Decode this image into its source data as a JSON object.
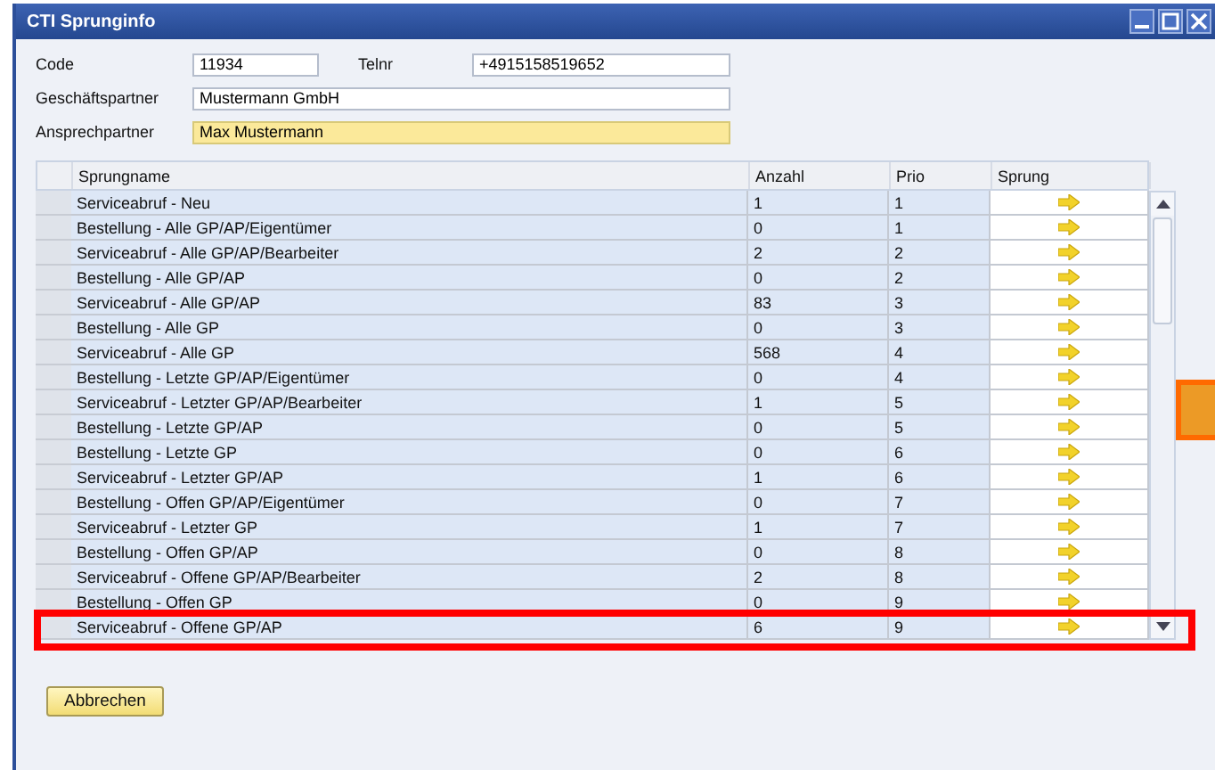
{
  "window": {
    "title": "CTI Sprunginfo"
  },
  "fields": [
    {
      "label": "Code",
      "value": "11934"
    },
    {
      "label": "Telnr",
      "value": "+4915158519652"
    },
    {
      "label": "Geschäftspartner",
      "value": "Mustermann GmbH"
    },
    {
      "label": "Ansprechpartner",
      "value": "Max Mustermann",
      "focused": true
    }
  ],
  "table": {
    "columns": [
      "Sprungname",
      "Anzahl",
      "Prio",
      "Sprung"
    ],
    "rows": [
      {
        "name": "Serviceabruf - Neu",
        "anzahl": "1",
        "prio": "1",
        "highlighted": false
      },
      {
        "name": "Bestellung - Alle GP/AP/Eigentümer",
        "anzahl": "0",
        "prio": "1",
        "highlighted": false
      },
      {
        "name": "Serviceabruf - Alle GP/AP/Bearbeiter",
        "anzahl": "2",
        "prio": "2",
        "highlighted": false
      },
      {
        "name": "Bestellung - Alle GP/AP",
        "anzahl": "0",
        "prio": "2",
        "highlighted": false
      },
      {
        "name": "Serviceabruf - Alle GP/AP",
        "anzahl": "83",
        "prio": "3",
        "highlighted": false
      },
      {
        "name": "Bestellung - Alle GP",
        "anzahl": "0",
        "prio": "3",
        "highlighted": false
      },
      {
        "name": "Serviceabruf - Alle GP",
        "anzahl": "568",
        "prio": "4",
        "highlighted": false
      },
      {
        "name": "Bestellung - Letzte GP/AP/Eigentümer",
        "anzahl": "0",
        "prio": "4",
        "highlighted": false
      },
      {
        "name": "Serviceabruf - Letzter GP/AP/Bearbeiter",
        "anzahl": "1",
        "prio": "5",
        "highlighted": false
      },
      {
        "name": "Bestellung - Letzte GP/AP",
        "anzahl": "0",
        "prio": "5",
        "highlighted": false
      },
      {
        "name": "Bestellung - Letzte GP",
        "anzahl": "0",
        "prio": "6",
        "highlighted": false
      },
      {
        "name": "Serviceabruf - Letzter GP/AP",
        "anzahl": "1",
        "prio": "6",
        "highlighted": false
      },
      {
        "name": "Bestellung - Offen GP/AP/Eigentümer",
        "anzahl": "0",
        "prio": "7",
        "highlighted": false
      },
      {
        "name": "Serviceabruf - Letzter GP",
        "anzahl": "1",
        "prio": "7",
        "highlighted": false
      },
      {
        "name": "Bestellung - Offen GP/AP",
        "anzahl": "0",
        "prio": "8",
        "highlighted": false
      },
      {
        "name": "Serviceabruf - Offene GP/AP/Bearbeiter",
        "anzahl": "2",
        "prio": "8",
        "highlighted": false
      },
      {
        "name": "Bestellung - Offen GP",
        "anzahl": "0",
        "prio": "9",
        "highlighted": false
      },
      {
        "name": "Serviceabruf - Offene GP/AP",
        "anzahl": "6",
        "prio": "9",
        "highlighted": true
      }
    ]
  },
  "buttons": [
    "Abbrechen"
  ]
}
